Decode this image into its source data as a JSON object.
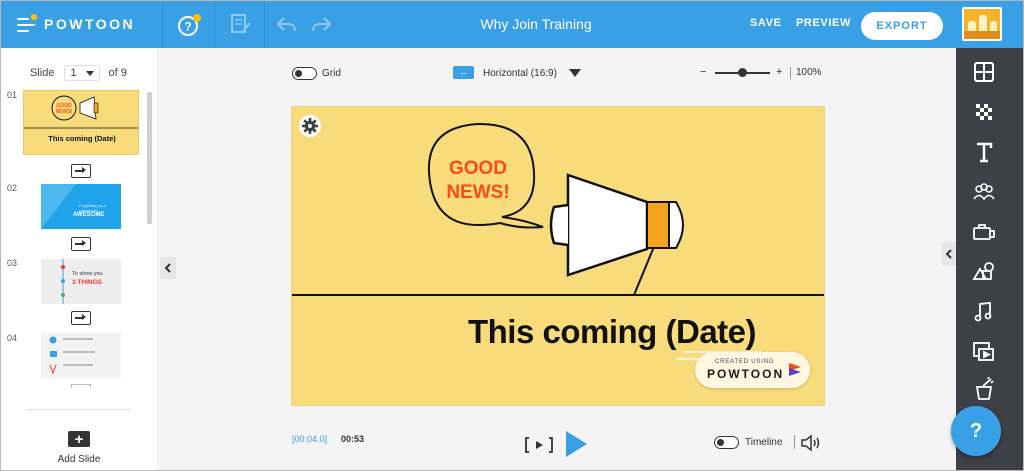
{
  "topbar": {
    "logo": "POWTOON",
    "title": "Why Join Training",
    "save_label": "SAVE",
    "preview_label": "PREVIEW",
    "export_label": "EXPORT"
  },
  "slides_panel": {
    "slide_label": "Slide",
    "current_slide": "1",
    "total_label": "of 9",
    "add_slide_label": "Add Slide",
    "slides": [
      {
        "number": "01",
        "title": "This coming (Date)",
        "badge": "GOOD NEWS!"
      },
      {
        "number": "02",
        "small": "Forgetting your password?",
        "title": "AWESOME"
      },
      {
        "number": "03",
        "small": "To show you",
        "title": "3 THINGS"
      },
      {
        "number": "04"
      }
    ]
  },
  "canvas_toolbar": {
    "grid_label": "Grid",
    "orientation_label": "Horizontal (16:9)",
    "zoom_minus": "−",
    "zoom_plus": "+",
    "zoom_value": "100%",
    "zoom_level_fraction": 0.5
  },
  "stage": {
    "speech_bubble_text": [
      "GOOD",
      "NEWS!"
    ],
    "headline": "This coming (Date)",
    "created_using": "CREATED USING",
    "brand": "POWTOON"
  },
  "playback": {
    "current_time": "[00:04.0]",
    "duration": "00:53",
    "timeline_label": "Timeline"
  },
  "right_toolbar": {
    "items": [
      "layout-icon",
      "background-icon",
      "text-icon",
      "characters-icon",
      "props-icon",
      "shapes-icon",
      "music-icon",
      "media-icon",
      "magic-icon"
    ]
  },
  "help_label": "?",
  "colors": {
    "brand_blue": "#3aa0e6",
    "slide_yellow": "#f8dc7c",
    "accent_orange": "#f6a21e",
    "alert_red": "#ff4a14",
    "toolbar_dark": "#3d4147"
  }
}
